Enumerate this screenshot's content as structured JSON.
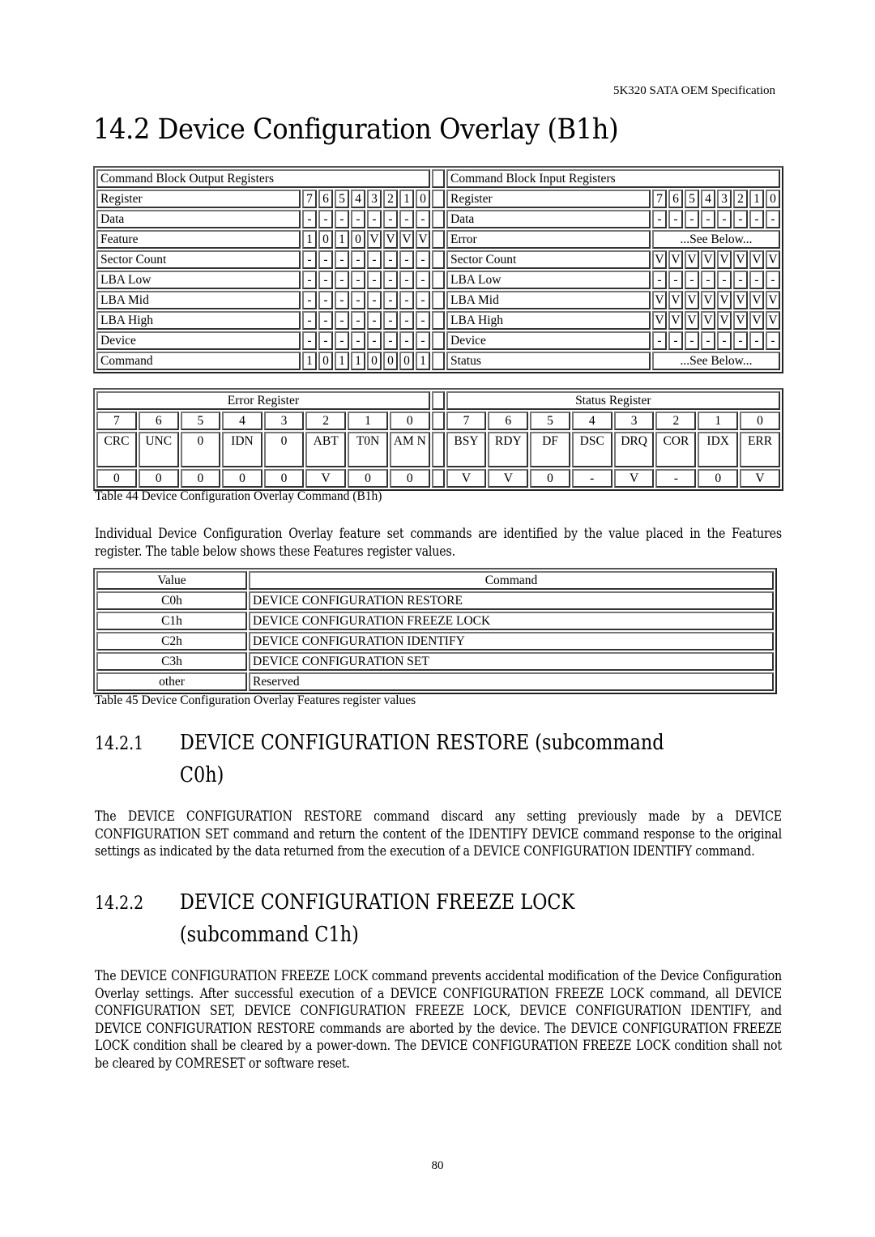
{
  "header": {
    "running_title": "5K320 SATA OEM Specification"
  },
  "section": {
    "title": "14.2 Device Configuration Overlay (B1h)"
  },
  "command_table": {
    "output_header": "Command Block Output Registers",
    "input_header": "Command Block Input Registers",
    "bit_labels": [
      "7",
      "6",
      "5",
      "4",
      "3",
      "2",
      "1",
      "0"
    ],
    "output_rows": [
      {
        "register": "Register",
        "bits": [
          "7",
          "6",
          "5",
          "4",
          "3",
          "2",
          "1",
          "0"
        ]
      },
      {
        "register": "Data",
        "bits": [
          "-",
          "-",
          "-",
          "-",
          "-",
          "-",
          "-",
          "-"
        ]
      },
      {
        "register": "Feature",
        "bits": [
          "1",
          "0",
          "1",
          "0",
          "V",
          "V",
          "V",
          "V"
        ]
      },
      {
        "register": "Sector Count",
        "bits": [
          "-",
          "-",
          "-",
          "-",
          "-",
          "-",
          "-",
          "-"
        ]
      },
      {
        "register": "LBA Low",
        "bits": [
          "-",
          "-",
          "-",
          "-",
          "-",
          "-",
          "-",
          "-"
        ]
      },
      {
        "register": "LBA Mid",
        "bits": [
          "-",
          "-",
          "-",
          "-",
          "-",
          "-",
          "-",
          "-"
        ]
      },
      {
        "register": "LBA High",
        "bits": [
          "-",
          "-",
          "-",
          "-",
          "-",
          "-",
          "-",
          "-"
        ]
      },
      {
        "register": "Device",
        "bits": [
          "-",
          "-",
          "-",
          "-",
          "-",
          "-",
          "-",
          "-"
        ]
      },
      {
        "register": "Command",
        "bits": [
          "1",
          "0",
          "1",
          "1",
          "0",
          "0",
          "0",
          "1"
        ]
      }
    ],
    "input_rows": [
      {
        "register": "Register",
        "bits": [
          "7",
          "6",
          "5",
          "4",
          "3",
          "2",
          "1",
          "0"
        ]
      },
      {
        "register": "Data",
        "bits": [
          "-",
          "-",
          "-",
          "-",
          "-",
          "-",
          "-",
          "-"
        ]
      },
      {
        "register": "Error",
        "span": "...See Below..."
      },
      {
        "register": "Sector Count",
        "bits": [
          "V",
          "V",
          "V",
          "V",
          "V",
          "V",
          "V",
          "V"
        ]
      },
      {
        "register": "LBA Low",
        "bits": [
          "-",
          "-",
          "-",
          "-",
          "-",
          "-",
          "-",
          "-"
        ]
      },
      {
        "register": "LBA Mid",
        "bits": [
          "V",
          "V",
          "V",
          "V",
          "V",
          "V",
          "V",
          "V"
        ]
      },
      {
        "register": "LBA High",
        "bits": [
          "V",
          "V",
          "V",
          "V",
          "V",
          "V",
          "V",
          "V"
        ]
      },
      {
        "register": "Device",
        "bits": [
          "-",
          "-",
          "-",
          "-",
          "-",
          "-",
          "-",
          "-"
        ]
      },
      {
        "register": "Status",
        "span": "...See Below..."
      }
    ]
  },
  "bits_table": {
    "error_title": "Error Register",
    "status_title": "Status Register",
    "bit_numbers": [
      "7",
      "6",
      "5",
      "4",
      "3",
      "2",
      "1",
      "0"
    ],
    "error_names": [
      "CRC",
      "UNC",
      "0",
      "IDN",
      "0",
      "ABT",
      "T0N",
      "AM N"
    ],
    "error_values": [
      "0",
      "0",
      "0",
      "0",
      "0",
      "V",
      "0",
      "0"
    ],
    "status_names": [
      "BSY",
      "RDY",
      "DF",
      "DSC",
      "DRQ",
      "COR",
      "IDX",
      "ERR"
    ],
    "status_values": [
      "V",
      "V",
      "0",
      "-",
      "V",
      "-",
      "0",
      "V"
    ]
  },
  "captions": {
    "table44": "Table 44 Device Configuration Overlay Command (B1h)",
    "table45": "Table 45 Device Configuration Overlay Features register values"
  },
  "intro_paragraph": "Individual Device Configuration Overlay feature set commands are identified by the value placed in the Features register. The table below shows these Features register values.",
  "features_table": {
    "headers": [
      "Value",
      "Command"
    ],
    "rows": [
      {
        "value": "C0h",
        "command": "DEVICE CONFIGURATION RESTORE"
      },
      {
        "value": "C1h",
        "command": "DEVICE CONFIGURATION FREEZE LOCK"
      },
      {
        "value": "C2h",
        "command": "DEVICE CONFIGURATION IDENTIFY"
      },
      {
        "value": "C3h",
        "command": "DEVICE CONFIGURATION SET"
      },
      {
        "value": "other",
        "command": "Reserved"
      }
    ]
  },
  "subsections": [
    {
      "number": "14.2.1",
      "title_line1": "DEVICE CONFIGURATION RESTORE (subcommand",
      "title_line2": "C0h)",
      "body": "The DEVICE CONFIGURATION RESTORE command discard any setting previously made by a DEVICE CONFIGURATION SET command and return the content of the IDENTIFY DEVICE command response to the original settings as indicated by the data returned from the execution of a DEVICE CONFIGURATION IDENTIFY command."
    },
    {
      "number": "14.2.2",
      "title_line1": "DEVICE CONFIGURATION FREEZE LOCK",
      "title_line2": "(subcommand C1h)",
      "body": "The DEVICE CONFIGURATION FREEZE LOCK command prevents accidental modification of the Device Configuration Overlay settings. After successful execution of a DEVICE CONFIGURATION FREEZE LOCK command, all DEVICE CONFIGURATION SET, DEVICE CONFIGURATION FREEZE LOCK, DEVICE CONFIGURATION IDENTIFY, and DEVICE CONFIGURATION RESTORE commands are aborted by the device. The DEVICE CONFIGURATION FREEZE LOCK condition shall be cleared by a power-down. The DEVICE CONFIGURATION FREEZE LOCK condition shall not be cleared by COMRESET or software reset."
    }
  ],
  "footer": {
    "page_number": "80"
  }
}
